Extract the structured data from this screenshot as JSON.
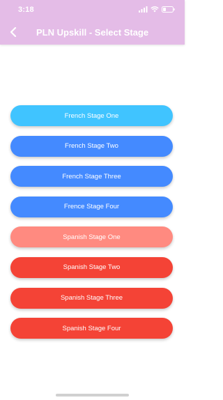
{
  "status_bar": {
    "time": "3:18",
    "icons": [
      "signal-icon",
      "wifi-icon",
      "battery-icon"
    ]
  },
  "nav": {
    "title": "PLN Upskill - Select Stage",
    "back_icon": "chevron-left-icon",
    "header_color": "#e4bce7"
  },
  "stages": [
    {
      "label": "French Stage One",
      "color": "#40c4ff"
    },
    {
      "label": "French Stage Two",
      "color": "#448aff"
    },
    {
      "label": "French Stage Three",
      "color": "#448aff"
    },
    {
      "label": "Frence Stage Four",
      "color": "#448aff"
    },
    {
      "label": "Spanish Stage One",
      "color": "#ff8a80"
    },
    {
      "label": "Spanish Stage Two",
      "color": "#f44336"
    },
    {
      "label": "Spanish Stage Three",
      "color": "#f44336"
    },
    {
      "label": "Spanish Stage Four",
      "color": "#f44336"
    }
  ]
}
